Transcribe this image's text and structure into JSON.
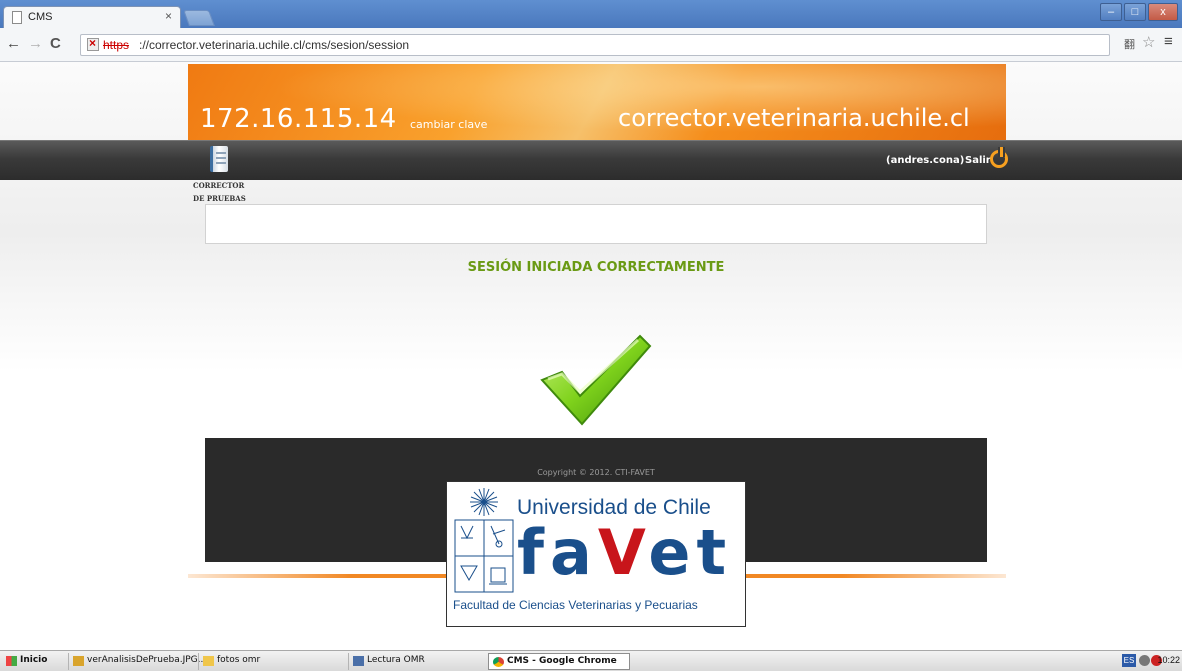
{
  "browser": {
    "tab_title": "CMS",
    "tab_close": "×",
    "url_protocol": "https",
    "url_rest": "://corrector.veterinaria.uchile.cl/cms/sesion/session",
    "window_min": "–",
    "window_max": "□",
    "window_close": "x",
    "back_glyph": "←",
    "forward_glyph": "→",
    "reload_glyph": "C",
    "star_glyph": "☆",
    "menu_glyph": "≡",
    "translate_glyph": "翻"
  },
  "header": {
    "server_ip": "172.16.115.14",
    "change_password": "cambiar clave",
    "site_host": "corrector.veterinaria.uchile.cl",
    "user": "(andres.cona)",
    "logout": "Salir"
  },
  "module": {
    "line1": "CORRECTOR",
    "line2": "DE PRUEBAS"
  },
  "main": {
    "status_message": "SESIÓN INICIADA CORRECTAMENTE"
  },
  "footer": {
    "copyright": "Copyright © 2012. CTI-FAVET"
  },
  "logo": {
    "university": "Universidad de Chile",
    "wordmark_a": "fa",
    "wordmark_v": "V",
    "wordmark_b": "et",
    "faculty": "Facultad de Ciencias Veterinarias y Pecuarias"
  },
  "colors": {
    "header_orange": "#f58e1c",
    "status_green": "#6a9a14",
    "favet_blue": "#1a4f8b",
    "favet_red": "#c8151b"
  },
  "taskbar": {
    "start": "Inicio",
    "items": [
      "verAnalisisDePrueba.JPG...",
      "fotos omr",
      "Lectura OMR",
      "CMS - Google Chrome"
    ],
    "lang": "ES",
    "clock": "10:22"
  }
}
